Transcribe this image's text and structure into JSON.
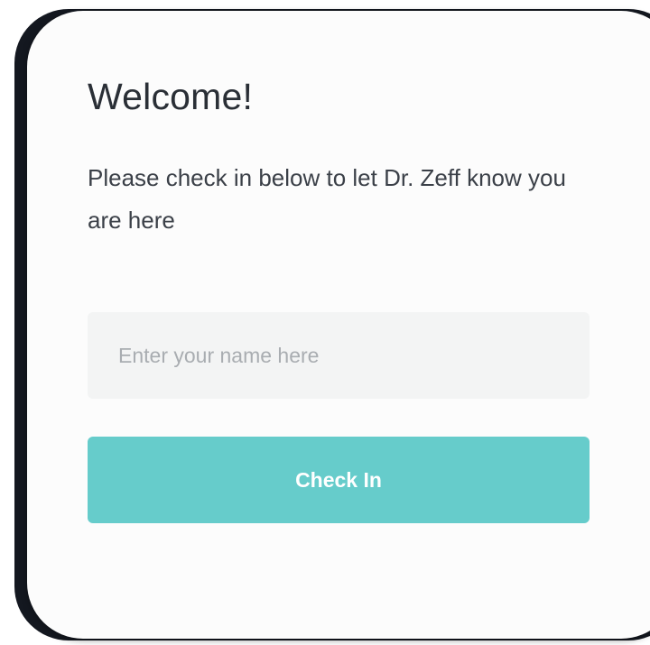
{
  "checkin": {
    "title": "Welcome!",
    "subtitle": "Please check in below to let Dr. Zeff know you are here",
    "name_input": {
      "placeholder": "Enter your name here",
      "value": ""
    },
    "submit_label": "Check In"
  },
  "colors": {
    "accent": "#66cccb",
    "card_background": "#fcfcfc",
    "frame": "#141820",
    "input_background": "#f3f4f4"
  }
}
